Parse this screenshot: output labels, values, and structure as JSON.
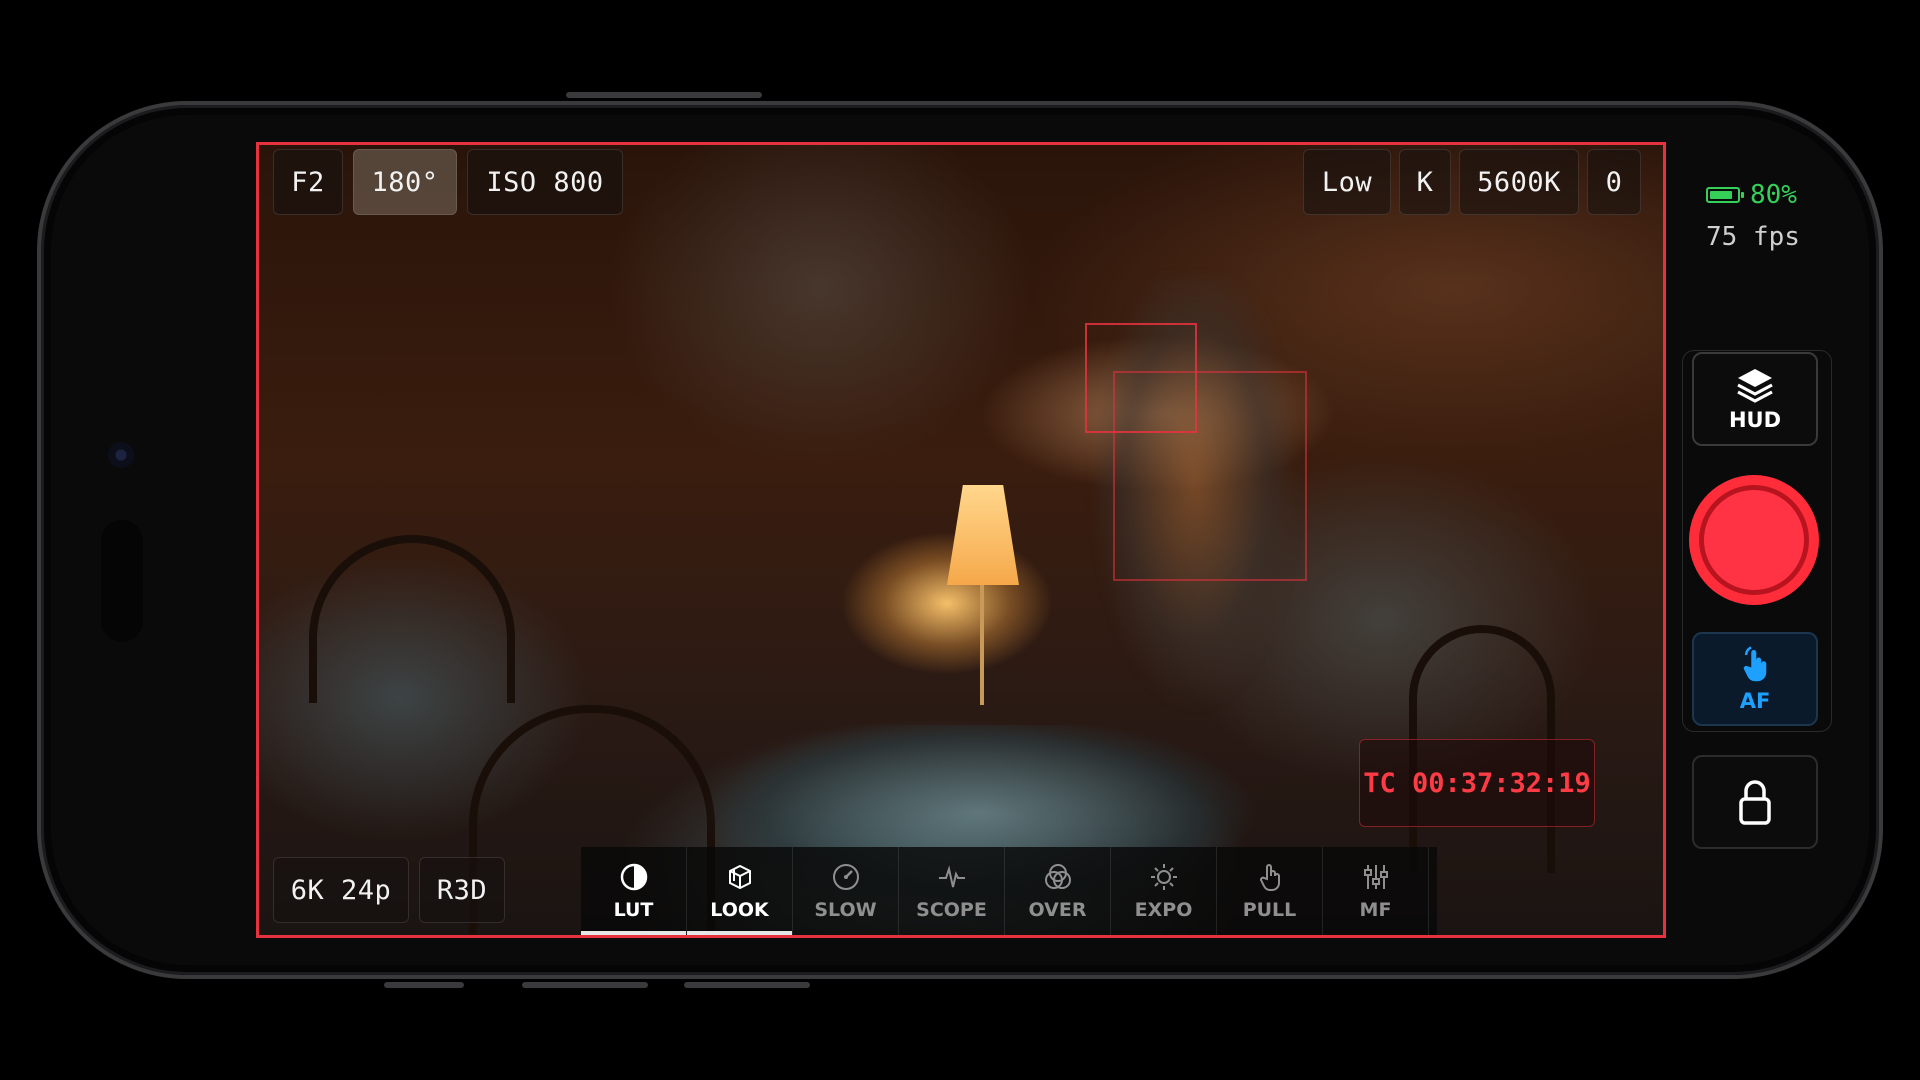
{
  "top_left_controls": {
    "aperture": "F2",
    "shutter": "180°",
    "iso": "ISO 800"
  },
  "top_right_controls": {
    "gain": "Low",
    "kelvin_unit": "K",
    "white_balance": "5600K",
    "tint": "0"
  },
  "bottom_left_controls": {
    "resolution_fps": "6K 24p",
    "codec": "R3D"
  },
  "timecode": "TC 00:37:32:19",
  "toolbar": {
    "items": [
      {
        "label": "LUT",
        "icon": "contrast-icon",
        "active": true
      },
      {
        "label": "LOOK",
        "icon": "cube-stack-icon",
        "active": true
      },
      {
        "label": "SLOW",
        "icon": "gauge-icon",
        "active": false
      },
      {
        "label": "SCOPE",
        "icon": "waveform-icon",
        "active": false
      },
      {
        "label": "OVER",
        "icon": "overlay-circles-icon",
        "active": false
      },
      {
        "label": "EXPO",
        "icon": "sun-icon",
        "active": false
      },
      {
        "label": "PULL",
        "icon": "hand-pointer-icon",
        "active": false
      },
      {
        "label": "MF",
        "icon": "sliders-icon",
        "active": false
      }
    ]
  },
  "status": {
    "battery": "80%",
    "fps": "75 fps"
  },
  "right_rail": {
    "hud_label": "HUD",
    "af_label": "AF"
  },
  "colors": {
    "accent_red": "#e6323e",
    "record_red": "#ff2d3a",
    "battery_green": "#35d05a",
    "af_blue": "#1ea0ff"
  }
}
